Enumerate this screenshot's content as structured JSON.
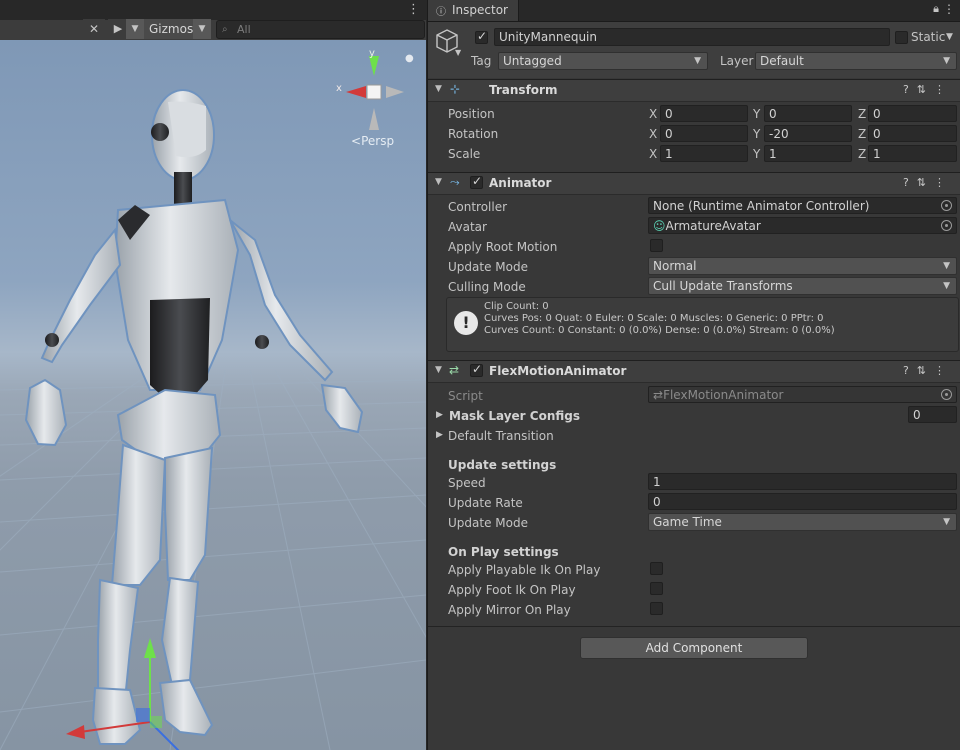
{
  "scene": {
    "toolbar": {
      "gizmos_label": "Gizmos",
      "search_placeholder": "All",
      "tools_icon": "tools-icon",
      "camera_icon": "camera-icon"
    },
    "view": {
      "projection_label": "Persp",
      "axis_x": "x",
      "axis_y": "y"
    }
  },
  "inspector": {
    "tab_label": "Inspector",
    "object": {
      "name": "UnityMannequin",
      "active": true,
      "static_label": "Static",
      "tag_label": "Tag",
      "tag_value": "Untagged",
      "layer_label": "Layer",
      "layer_value": "Default"
    },
    "transform": {
      "title": "Transform",
      "rows": [
        {
          "label": "Position",
          "x": "0",
          "y": "0",
          "z": "0"
        },
        {
          "label": "Rotation",
          "x": "0",
          "y": "-20",
          "z": "0"
        },
        {
          "label": "Scale",
          "x": "1",
          "y": "1",
          "z": "1"
        }
      ],
      "axis_x": "X",
      "axis_y": "Y",
      "axis_z": "Z"
    },
    "animator": {
      "title": "Animator",
      "enabled": true,
      "controller_label": "Controller",
      "controller_value": "None (Runtime Animator Controller)",
      "avatar_label": "Avatar",
      "avatar_value": "ArmatureAvatar",
      "apply_root_motion_label": "Apply Root Motion",
      "apply_root_motion": false,
      "update_mode_label": "Update Mode",
      "update_mode_value": "Normal",
      "culling_mode_label": "Culling Mode",
      "culling_mode_value": "Cull Update Transforms",
      "info_lines": [
        "Clip Count: 0",
        "Curves Pos: 0 Quat: 0 Euler: 0 Scale: 0 Muscles: 0 Generic: 0 PPtr: 0",
        "Curves Count: 0 Constant: 0 (0.0%) Dense: 0 (0.0%) Stream: 0 (0.0%)"
      ]
    },
    "flex": {
      "title": "FlexMotionAnimator",
      "enabled": true,
      "script_label": "Script",
      "script_value": "FlexMotionAnimator",
      "mask_layer_label": "Mask Layer Configs",
      "mask_layer_count": "0",
      "default_transition_label": "Default Transition",
      "update_settings_title": "Update settings",
      "speed_label": "Speed",
      "speed_value": "1",
      "update_rate_label": "Update Rate",
      "update_rate_value": "0",
      "update_mode_label": "Update Mode",
      "update_mode_value": "Game Time",
      "on_play_title": "On Play settings",
      "playable_ik_label": "Apply Playable Ik On Play",
      "foot_ik_label": "Apply Foot Ik On Play",
      "mirror_label": "Apply Mirror On Play"
    },
    "add_component_label": "Add Component"
  },
  "colors": {
    "panel": "#383838",
    "header": "#3e3e3e",
    "field": "#2a2a2a",
    "sky_top": "#7f98b6",
    "axis_x": "#d23a3a",
    "axis_y": "#6ee04a",
    "axis_z": "#3b6fe0"
  }
}
